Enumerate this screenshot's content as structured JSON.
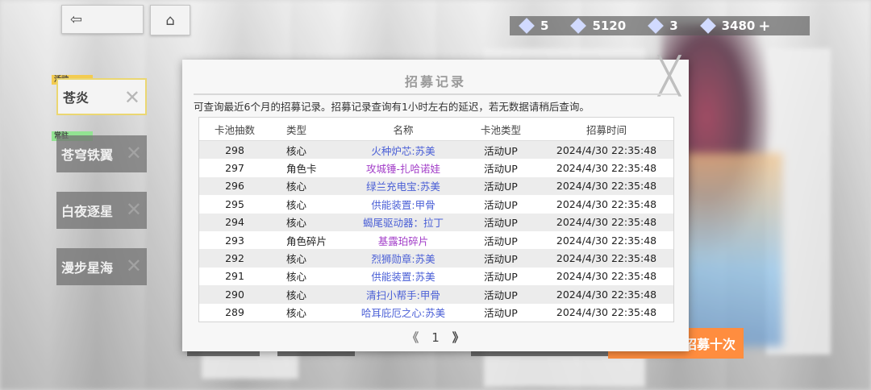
{
  "top": {
    "back_icon": "back-arrow-icon",
    "home_icon": "home-icon",
    "resources": [
      {
        "icon": "crystal-icon",
        "value": "5"
      },
      {
        "icon": "gem-icon",
        "value": "5120"
      },
      {
        "icon": "ticket-icon",
        "value": "3"
      },
      {
        "icon": "currency-icon",
        "value": "3480"
      }
    ],
    "add_symbol": "+"
  },
  "sidebar": {
    "items": [
      {
        "label": "苍炎",
        "tag": "活动",
        "active": true
      },
      {
        "label": "苍穹铁翼",
        "tag": "常驻",
        "active": false
      },
      {
        "label": "白夜逐星",
        "tag": "",
        "active": false
      },
      {
        "label": "漫步星海",
        "tag": "",
        "active": false
      }
    ]
  },
  "bottom": {
    "recruit_ten_label": "招募十次"
  },
  "modal": {
    "title": "招募记录",
    "close_symbol": "╳",
    "notice": "可查询最近6个月的招募记录。招募记录查询有1小时左右的延迟，若无数据请稍后查询。",
    "columns": [
      "卡池抽数",
      "类型",
      "名称",
      "卡池类型",
      "招募时间"
    ],
    "rows": [
      {
        "count": "298",
        "type": "核心",
        "name": "火种炉芯:苏美",
        "name_color": "#4a5fd6",
        "pool": "活动UP",
        "time": "2024/4/30 22:35:48"
      },
      {
        "count": "297",
        "type": "角色卡",
        "name": "攻城锤-扎哈诺娃",
        "name_color": "#a23dc8",
        "pool": "活动UP",
        "time": "2024/4/30 22:35:48"
      },
      {
        "count": "296",
        "type": "核心",
        "name": "绿兰充电宝:苏美",
        "name_color": "#4a5fd6",
        "pool": "活动UP",
        "time": "2024/4/30 22:35:48"
      },
      {
        "count": "295",
        "type": "核心",
        "name": "供能装置:甲骨",
        "name_color": "#4a5fd6",
        "pool": "活动UP",
        "time": "2024/4/30 22:35:48"
      },
      {
        "count": "294",
        "type": "核心",
        "name": "蝎尾驱动器：拉丁",
        "name_color": "#4a5fd6",
        "pool": "活动UP",
        "time": "2024/4/30 22:35:48"
      },
      {
        "count": "293",
        "type": "角色碎片",
        "name": "基露珀碎片",
        "name_color": "#a23dc8",
        "pool": "活动UP",
        "time": "2024/4/30 22:35:48"
      },
      {
        "count": "292",
        "type": "核心",
        "name": "烈狮勋章:苏美",
        "name_color": "#4a5fd6",
        "pool": "活动UP",
        "time": "2024/4/30 22:35:48"
      },
      {
        "count": "291",
        "type": "核心",
        "name": "供能装置:苏美",
        "name_color": "#4a5fd6",
        "pool": "活动UP",
        "time": "2024/4/30 22:35:48"
      },
      {
        "count": "290",
        "type": "核心",
        "name": "清扫小帮手:甲骨",
        "name_color": "#4a5fd6",
        "pool": "活动UP",
        "time": "2024/4/30 22:35:48"
      },
      {
        "count": "289",
        "type": "核心",
        "name": "哈耳庇厄之心:苏美",
        "name_color": "#4a5fd6",
        "pool": "活动UP",
        "time": "2024/4/30 22:35:48"
      }
    ],
    "pager": {
      "prev": "《",
      "page": "1",
      "next": "》"
    }
  },
  "colors": {
    "accent_orange": "#ff7a1e",
    "name_blue": "#4a5fd6",
    "name_purple": "#a23dc8",
    "active_tab_border": "#e8d15a"
  }
}
